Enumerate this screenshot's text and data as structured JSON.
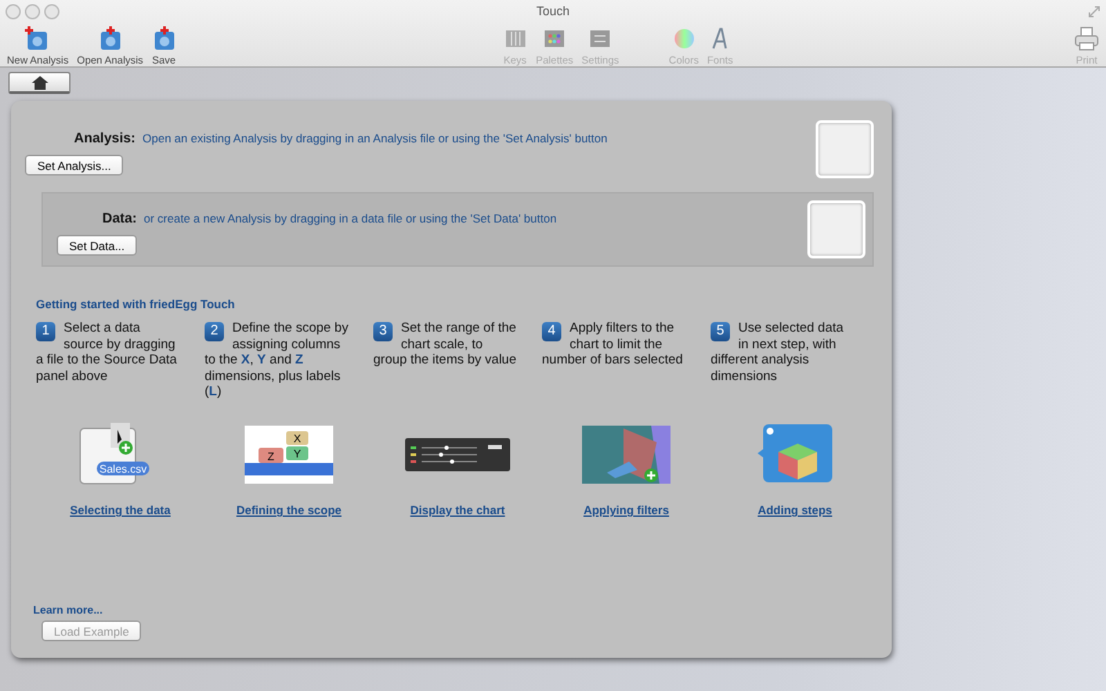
{
  "window": {
    "title": "Touch"
  },
  "toolbar": [
    {
      "label": "New Analysis",
      "kind": "new",
      "disabled": false
    },
    {
      "label": "Open Analysis",
      "kind": "open",
      "disabled": false
    },
    {
      "label": "Save",
      "kind": "save",
      "disabled": false
    },
    {
      "label": "Keys",
      "kind": "keys",
      "disabled": true
    },
    {
      "label": "Palettes",
      "kind": "palettes",
      "disabled": true
    },
    {
      "label": "Settings",
      "kind": "settings",
      "disabled": true
    },
    {
      "label": "Colors",
      "kind": "colors",
      "disabled": true
    },
    {
      "label": "Fonts",
      "kind": "fonts",
      "disabled": true
    },
    {
      "label": "Print",
      "kind": "print",
      "disabled": true
    }
  ],
  "analysis": {
    "label": "Analysis:",
    "hint": "Open an existing Analysis by dragging in an Analysis file or using the 'Set Analysis' button",
    "button": "Set Analysis..."
  },
  "data": {
    "label": "Data:",
    "hint": "or create a new Analysis by dragging in a data file or using the 'Set Data' button",
    "button": "Set Data..."
  },
  "getting_started": {
    "title": "Getting started with friedEgg Touch",
    "steps": [
      {
        "number": "1",
        "text": "Select a data source by dragging a file to the Source Data panel above",
        "thumbnail": {
          "kind": "file",
          "texts": [
            "Sales.csv"
          ]
        },
        "link": "Selecting the data"
      },
      {
        "number": "2",
        "text": "Define the scope by assigning columns to the **X**, **Y** and **Z** dimensions, plus labels (**L**)",
        "thumbnail": {
          "kind": "tags",
          "texts": [
            "X",
            "Z",
            "Y"
          ]
        },
        "link": "Defining the scope"
      },
      {
        "number": "3",
        "text": "Set the range of the chart scale, to group the items by value",
        "thumbnail": {
          "kind": "panel"
        },
        "link": "Display the chart"
      },
      {
        "number": "4",
        "text": "Apply filters to the chart to limit the number of bars selected",
        "thumbnail": {
          "kind": "filter"
        },
        "link": "Applying filters"
      },
      {
        "number": "5",
        "text": "Use selected data in next step, with different analysis dimensions",
        "thumbnail": {
          "kind": "cube"
        },
        "link": "Adding steps"
      }
    ]
  },
  "learn_more": "Learn more...",
  "load_example": {
    "label": "Load Example",
    "disabled": true
  }
}
